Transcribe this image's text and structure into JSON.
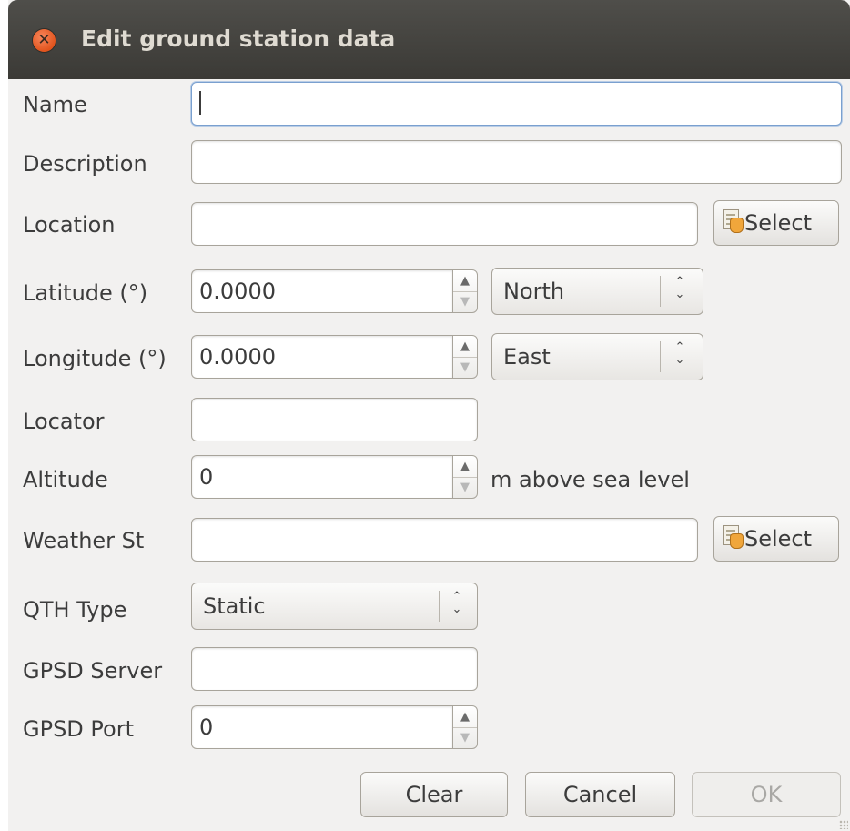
{
  "window": {
    "title": "Edit ground station data"
  },
  "form": {
    "name": {
      "label": "Name",
      "value": ""
    },
    "description": {
      "label": "Description",
      "value": ""
    },
    "location": {
      "label": "Location",
      "value": "",
      "button": "Select"
    },
    "latitude": {
      "label": "Latitude (°)",
      "value": "0.0000",
      "direction": "North"
    },
    "longitude": {
      "label": "Longitude (°)",
      "value": "0.0000",
      "direction": "East"
    },
    "locator": {
      "label": "Locator",
      "value": ""
    },
    "altitude": {
      "label": "Altitude",
      "value": "0",
      "unit": "m above sea level"
    },
    "weather": {
      "label": "Weather St",
      "value": "",
      "button": "Select"
    },
    "qth_type": {
      "label": "QTH Type",
      "value": "Static"
    },
    "gpsd_server": {
      "label": "GPSD Server",
      "value": ""
    },
    "gpsd_port": {
      "label": "GPSD Port",
      "value": "0"
    }
  },
  "buttons": {
    "clear": "Clear",
    "cancel": "Cancel",
    "ok": "OK"
  },
  "icons": {
    "close": "close-icon",
    "select": "document-hand-icon",
    "spin_up": "arrow-up-icon",
    "spin_down": "arrow-down-icon",
    "combo": "up-down-arrows-icon"
  },
  "colors": {
    "titlebar": "#3c3b37",
    "close": "#e95420",
    "focus": "#7aa0cf"
  }
}
